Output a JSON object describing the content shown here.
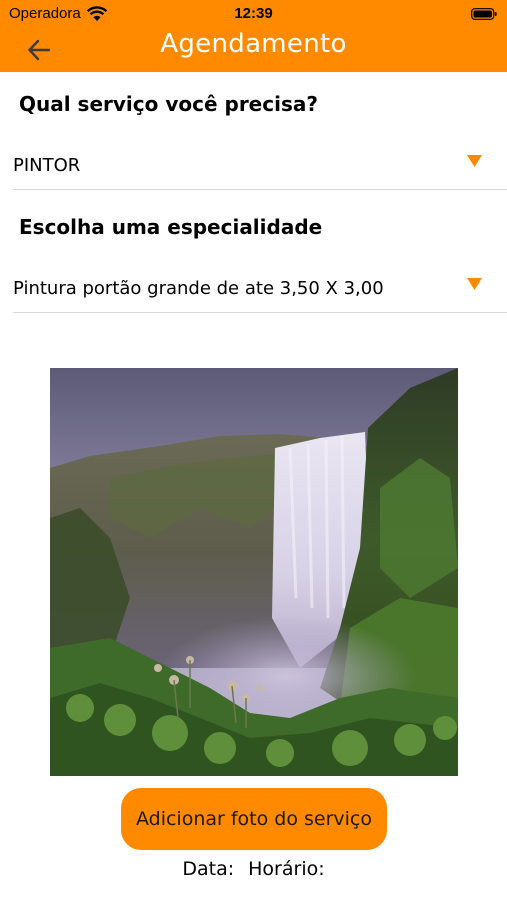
{
  "status_bar": {
    "carrier": "Operadora",
    "time": "12:39",
    "icons": [
      "wifi-icon",
      "battery-icon"
    ]
  },
  "nav": {
    "title": "Agendamento",
    "back_icon": "arrow-left-icon"
  },
  "service": {
    "label": "Qual serviço você precisa?",
    "selected": "PINTOR",
    "icon": "dropdown-triangle-icon"
  },
  "specialty": {
    "label": "Escolha uma especialidade",
    "selected": "Pintura portão grande de ate 3,50 X 3,00",
    "icon": "dropdown-triangle-icon"
  },
  "photo": {
    "subject": "waterfall"
  },
  "add_photo_button": "Adicionar foto do serviço",
  "schedule": {
    "date_label": "Data:",
    "time_label": "Horário:"
  },
  "colors": {
    "accent": "#ff8a00",
    "header_text": "#ffffff"
  }
}
